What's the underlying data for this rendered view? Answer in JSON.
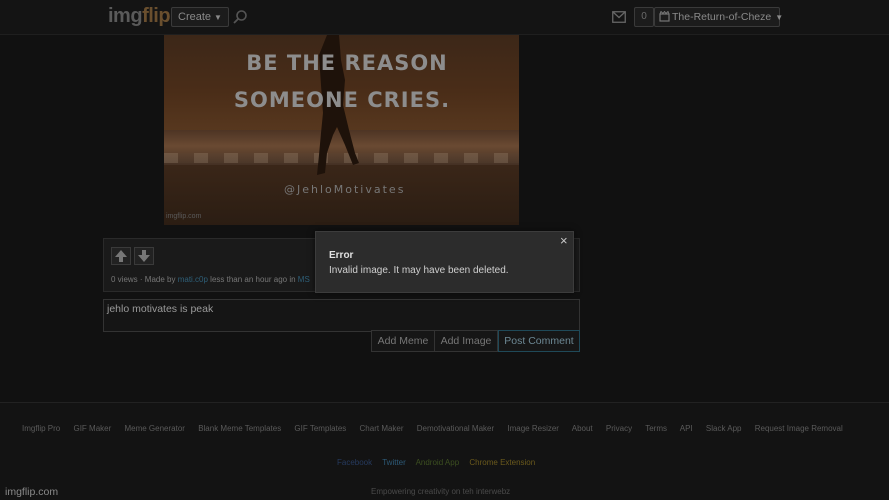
{
  "header": {
    "logo_main": "img",
    "logo_flip": "flip",
    "create_label": "Create",
    "notification_count": "0",
    "username": "The-Return-of-Cheze"
  },
  "meme": {
    "line1": "BE THE REASON",
    "line2": "SOMEONE CRIES.",
    "handle": "@JehloMotivates",
    "watermark": "imgflip.com"
  },
  "post_info": {
    "views": "0 views",
    "made_by_prefix": " · Made by ",
    "author": "mati.c0p",
    "time_text": " less than an hour ago in ",
    "stream_partial": "MS"
  },
  "comment": {
    "text": "jehlo motivates is peak"
  },
  "buttons": {
    "add_meme": "Add Meme",
    "add_image": "Add Image",
    "post_comment": "Post Comment"
  },
  "dialog": {
    "close": "×",
    "title": "Error",
    "message": "Invalid image. It may have been deleted."
  },
  "footer": {
    "links": [
      "Imgflip Pro",
      "GIF Maker",
      "Meme Generator",
      "Blank Meme Templates",
      "GIF Templates",
      "Chart Maker",
      "Demotivational Maker",
      "Image Resizer",
      "About",
      "Privacy",
      "Terms",
      "API",
      "Slack App",
      "Request Image Removal"
    ],
    "social": {
      "facebook": "Facebook",
      "twitter": "Twitter",
      "android": "Android App",
      "chrome": "Chrome Extension"
    },
    "tagline": "Empowering creativity on teh interwebz"
  },
  "page_watermark": "imgflip.com",
  "colors": {
    "page_bg": "#111111",
    "dialog_bg": "#2c2c2c",
    "post_button_border": "#1f4958"
  }
}
